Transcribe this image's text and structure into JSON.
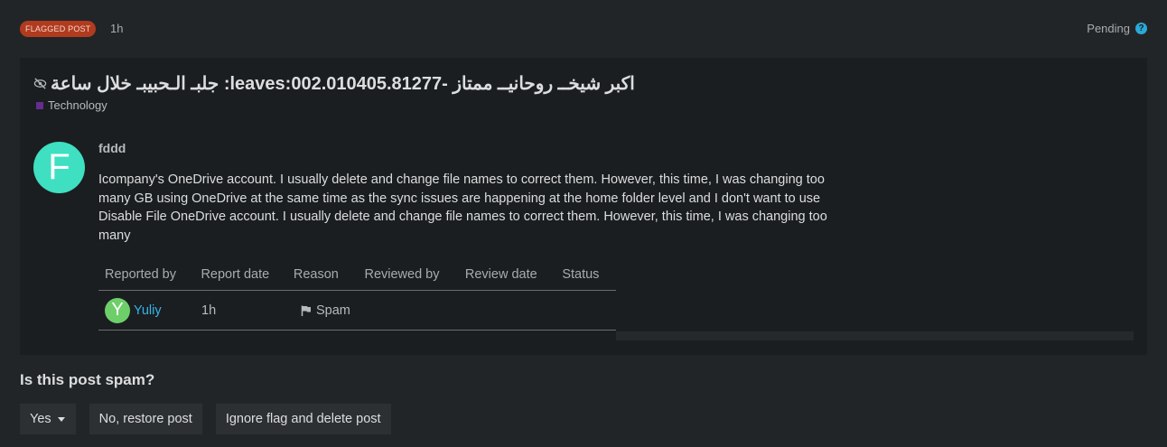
{
  "header": {
    "badge": "FLAGGED POST",
    "age": "1h",
    "status": "Pending",
    "help_icon": "question-circle-icon"
  },
  "post": {
    "title": "اكبر شيخــ روحانيــ ممتاز -leaves:002.010405.81277: جلبـ الـحبيبـ خلال ساعة",
    "category": "Technology",
    "category_color": "#652d90",
    "author_initial": "F",
    "author_avatar_color": "#3ee0c1",
    "author": "fddd",
    "body": "Icompany's OneDrive account. I usually delete and change file names to correct them. However, this time, I was changing too many GB using OneDrive at the same time as the sync issues are happening at the home folder level and I don't want to use Disable File OneDrive account. I usually delete and change file names to correct them. However, this time, I was changing too many"
  },
  "reports": {
    "columns": [
      "Reported by",
      "Report date",
      "Reason",
      "Reviewed by",
      "Review date",
      "Status"
    ],
    "rows": [
      {
        "reporter_initial": "Y",
        "reporter": "Yuliy",
        "date": "1h",
        "reason": "Spam"
      }
    ]
  },
  "review": {
    "question": "Is this post spam?",
    "yes_label": "Yes",
    "restore_label": "No, restore post",
    "ignore_label": "Ignore flag and delete post"
  }
}
